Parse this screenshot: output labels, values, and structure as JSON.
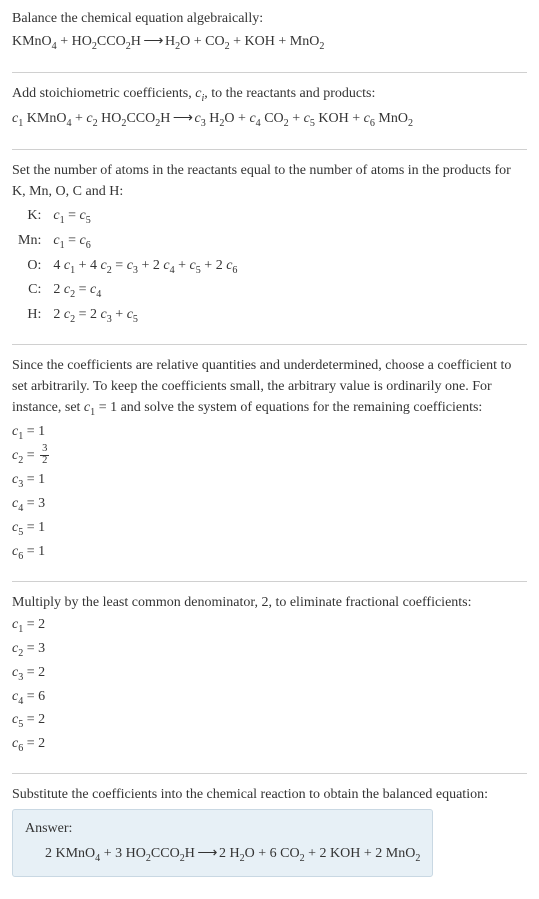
{
  "s1": {
    "intro": "Balance the chemical equation algebraically:",
    "eq_lhs1": "KMnO",
    "eq_lhs1s": "4",
    "plus1": " + HO",
    "eq_lhs2s": "2",
    "eq_lhs2b": "CCO",
    "eq_lhs2s2": "2",
    "eq_lhs2c": "H",
    "arrow": " ⟶ ",
    "rhs1": "H",
    "rhs1s": "2",
    "rhs1b": "O + CO",
    "rhs2s": "2",
    "rhs2b": " + KOH + MnO",
    "rhs3s": "2"
  },
  "s2": {
    "intro_a": "Add stoichiometric coefficients, ",
    "ci": "c",
    "ci_s": "i",
    "intro_b": ", to the reactants and products:",
    "eq": {
      "c1": "c",
      "c1s": "1",
      "t1": " KMnO",
      "t1s": "4",
      "p1": " + ",
      "c2": "c",
      "c2s": "2",
      "t2": " HO",
      "t2s": "2",
      "t2b": "CCO",
      "t2s2": "2",
      "t2c": "H",
      "arrow": " ⟶ ",
      "c3": "c",
      "c3s": "3",
      "t3": " H",
      "t3s": "2",
      "t3b": "O + ",
      "c4": "c",
      "c4s": "4",
      "t4": " CO",
      "t4s": "2",
      "t4b": " + ",
      "c5": "c",
      "c5s": "5",
      "t5": " KOH + ",
      "c6": "c",
      "c6s": "6",
      "t6": " MnO",
      "t6s": "2"
    }
  },
  "s3": {
    "intro": "Set the number of atoms in the reactants equal to the number of atoms in the products for K, Mn, O, C and H:",
    "rows": {
      "K": {
        "lbl": "K:",
        "eq_a": "c",
        "eq_as": "1",
        "eq_m": " = ",
        "eq_b": "c",
        "eq_bs": "5"
      },
      "Mn": {
        "lbl": "Mn:",
        "eq_a": "c",
        "eq_as": "1",
        "eq_m": " = ",
        "eq_b": "c",
        "eq_bs": "6"
      },
      "O": {
        "lbl": "O:",
        "t": "4 ",
        "a": "c",
        "as": "1",
        "p1": " + 4 ",
        "b": "c",
        "bs": "2",
        "m": " = ",
        "c": "c",
        "cs": "3",
        "p2": " + 2 ",
        "d": "c",
        "ds": "4",
        "p3": " + ",
        "e": "c",
        "es": "5",
        "p4": " + 2 ",
        "f": "c",
        "fs": "6"
      },
      "C": {
        "lbl": "C:",
        "t": "2 ",
        "a": "c",
        "as": "2",
        "m": " = ",
        "b": "c",
        "bs": "4"
      },
      "H": {
        "lbl": "H:",
        "t": "2 ",
        "a": "c",
        "as": "2",
        "m": " = 2 ",
        "b": "c",
        "bs": "3",
        "p": " + ",
        "c": "c",
        "cs": "5"
      }
    }
  },
  "s4": {
    "intro_a": "Since the coefficients are relative quantities and underdetermined, choose a coefficient to set arbitrarily. To keep the coefficients small, the arbitrary value is ordinarily one. For instance, set ",
    "c1": "c",
    "c1s": "1",
    "eqone": " = 1",
    "intro_b": " and solve the system of equations for the remaining coefficients:",
    "coefs": {
      "c1": {
        "c": "c",
        "s": "1",
        "v": " = 1"
      },
      "c2": {
        "c": "c",
        "s": "2",
        "v": " = ",
        "num": "3",
        "den": "2"
      },
      "c3": {
        "c": "c",
        "s": "3",
        "v": " = 1"
      },
      "c4": {
        "c": "c",
        "s": "4",
        "v": " = 3"
      },
      "c5": {
        "c": "c",
        "s": "5",
        "v": " = 1"
      },
      "c6": {
        "c": "c",
        "s": "6",
        "v": " = 1"
      }
    }
  },
  "s5": {
    "intro": "Multiply by the least common denominator, 2, to eliminate fractional coefficients:",
    "coefs": {
      "c1": {
        "c": "c",
        "s": "1",
        "v": " = 2"
      },
      "c2": {
        "c": "c",
        "s": "2",
        "v": " = 3"
      },
      "c3": {
        "c": "c",
        "s": "3",
        "v": " = 2"
      },
      "c4": {
        "c": "c",
        "s": "4",
        "v": " = 6"
      },
      "c5": {
        "c": "c",
        "s": "5",
        "v": " = 2"
      },
      "c6": {
        "c": "c",
        "s": "6",
        "v": " = 2"
      }
    }
  },
  "s6": {
    "intro": "Substitute the coefficients into the chemical reaction to obtain the balanced equation:",
    "answer_label": "Answer:",
    "eq": {
      "t1": "2 KMnO",
      "s1": "4",
      "p1": " + 3 HO",
      "s2": "2",
      "t2": "CCO",
      "s3": "2",
      "t3": "H",
      "arrow": " ⟶ ",
      "t4": "2 H",
      "s4": "2",
      "t5": "O + 6 CO",
      "s5": "2",
      "t6": " + 2 KOH + 2 MnO",
      "s6": "2"
    }
  }
}
